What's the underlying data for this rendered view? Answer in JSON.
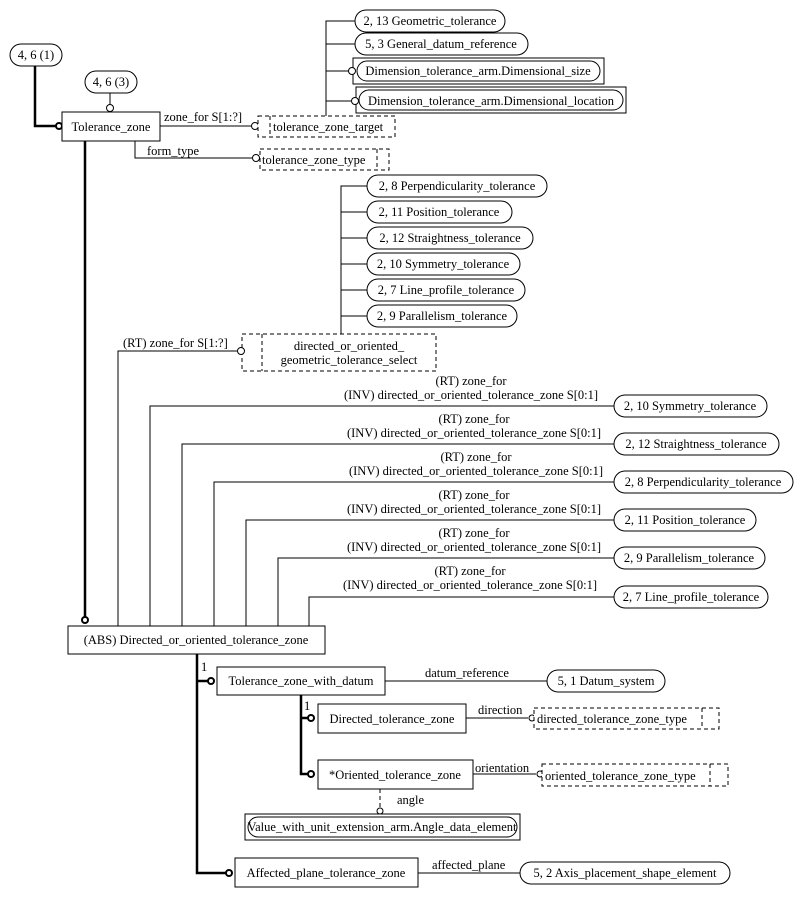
{
  "diagram": {
    "page_refs": {
      "ref_1": "4, 6 (1)",
      "ref_3": "4, 6 (3)"
    },
    "tolerance_zone": {
      "name": "Tolerance_zone",
      "zone_for_label": "zone_for S[1:?]",
      "zone_target": "tolerance_zone_target",
      "form_type_label": "form_type",
      "zone_type": "tolerance_zone_type",
      "targets": [
        "2, 13 Geometric_tolerance",
        "5, 3 General_datum_reference",
        "Dimension_tolerance_arm.Dimensional_size",
        "Dimension_tolerance_arm.Dimensional_location"
      ]
    },
    "select": {
      "line1": "directed_or_oriented_",
      "line2": "geometric_tolerance_select",
      "rt_label": "(RT) zone_for S[1:?]",
      "items": [
        "2, 8 Perpendicularity_tolerance",
        "2, 11 Position_tolerance",
        "2, 12 Straightness_tolerance",
        "2, 10 Symmetry_tolerance",
        "2, 7 Line_profile_tolerance",
        "2, 9 Parallelism_tolerance"
      ]
    },
    "inverse": {
      "rt": "(RT) zone_for",
      "inv": "(INV) directed_or_oriented_tolerance_zone S[0:1]",
      "targets": [
        "2, 10 Symmetry_tolerance",
        "2, 12 Straightness_tolerance",
        "2, 8 Perpendicularity_tolerance",
        "2, 11 Position_tolerance",
        "2, 9 Parallelism_tolerance",
        "2, 7 Line_profile_tolerance"
      ]
    },
    "abs_entity": "(ABS) Directed_or_oriented_tolerance_zone",
    "one_label": "1",
    "with_datum": {
      "name": "Tolerance_zone_with_datum",
      "attr": "datum_reference",
      "target": "5, 1 Datum_system"
    },
    "directed": {
      "name": "Directed_tolerance_zone",
      "attr": "direction",
      "target": "directed_tolerance_zone_type"
    },
    "oriented": {
      "name": "*Oriented_tolerance_zone",
      "attr": "orientation",
      "target": "oriented_tolerance_zone_type",
      "angle_label": "angle",
      "angle_target": "Value_with_unit_extension_arm.Angle_data_element"
    },
    "affected": {
      "name": "Affected_plane_tolerance_zone",
      "attr": "affected_plane",
      "target": "5, 2 Axis_placement_shape_element"
    }
  }
}
